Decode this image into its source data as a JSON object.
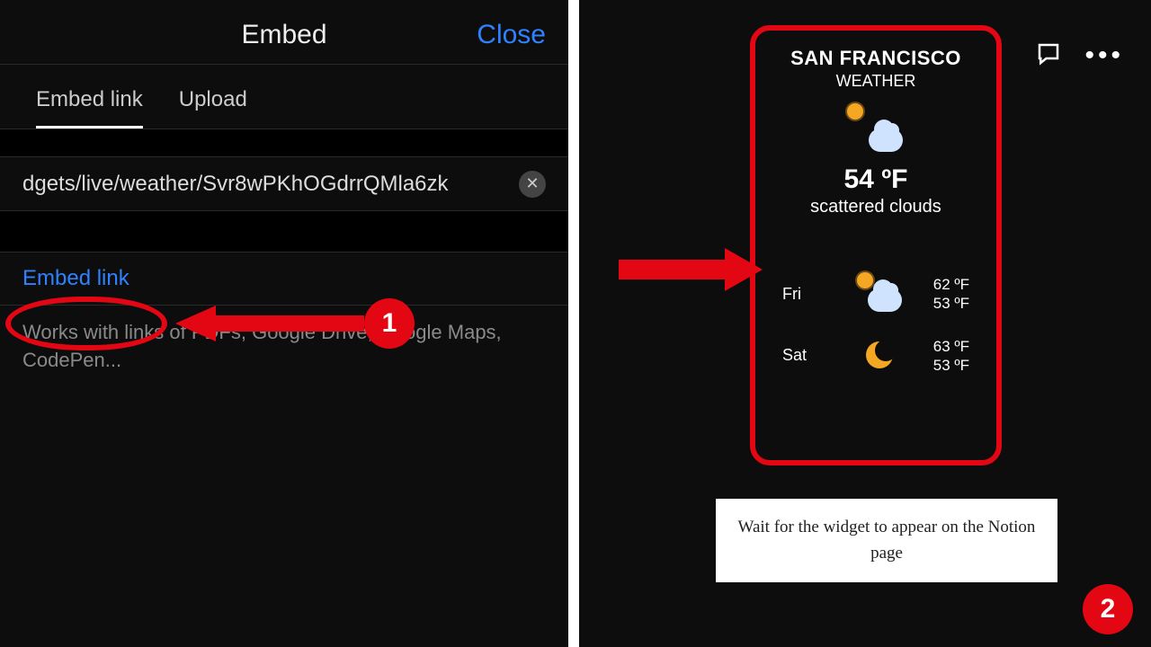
{
  "left": {
    "header": {
      "title": "Embed",
      "close": "Close"
    },
    "tabs": {
      "embed": "Embed link",
      "upload": "Upload"
    },
    "input": {
      "value": "dgets/live/weather/Svr8wPKhOGdrrQMla6zk"
    },
    "embed_action": "Embed link",
    "hint": "Works with links of PDFs, Google Drive, Google Maps, CodePen..."
  },
  "right": {
    "widget": {
      "city": "SAN FRANCISCO",
      "label": "WEATHER",
      "temp": "54 ºF",
      "desc": "scattered clouds",
      "forecast": [
        {
          "day": "Fri",
          "hi": "62 ºF",
          "lo": "53 ºF",
          "icon": "partly-cloudy"
        },
        {
          "day": "Sat",
          "hi": "63 ºF",
          "lo": "53 ºF",
          "icon": "night"
        }
      ]
    },
    "caption": "Wait for the widget to appear on the Notion page"
  },
  "annotations": {
    "badge1": "1",
    "badge2": "2"
  }
}
